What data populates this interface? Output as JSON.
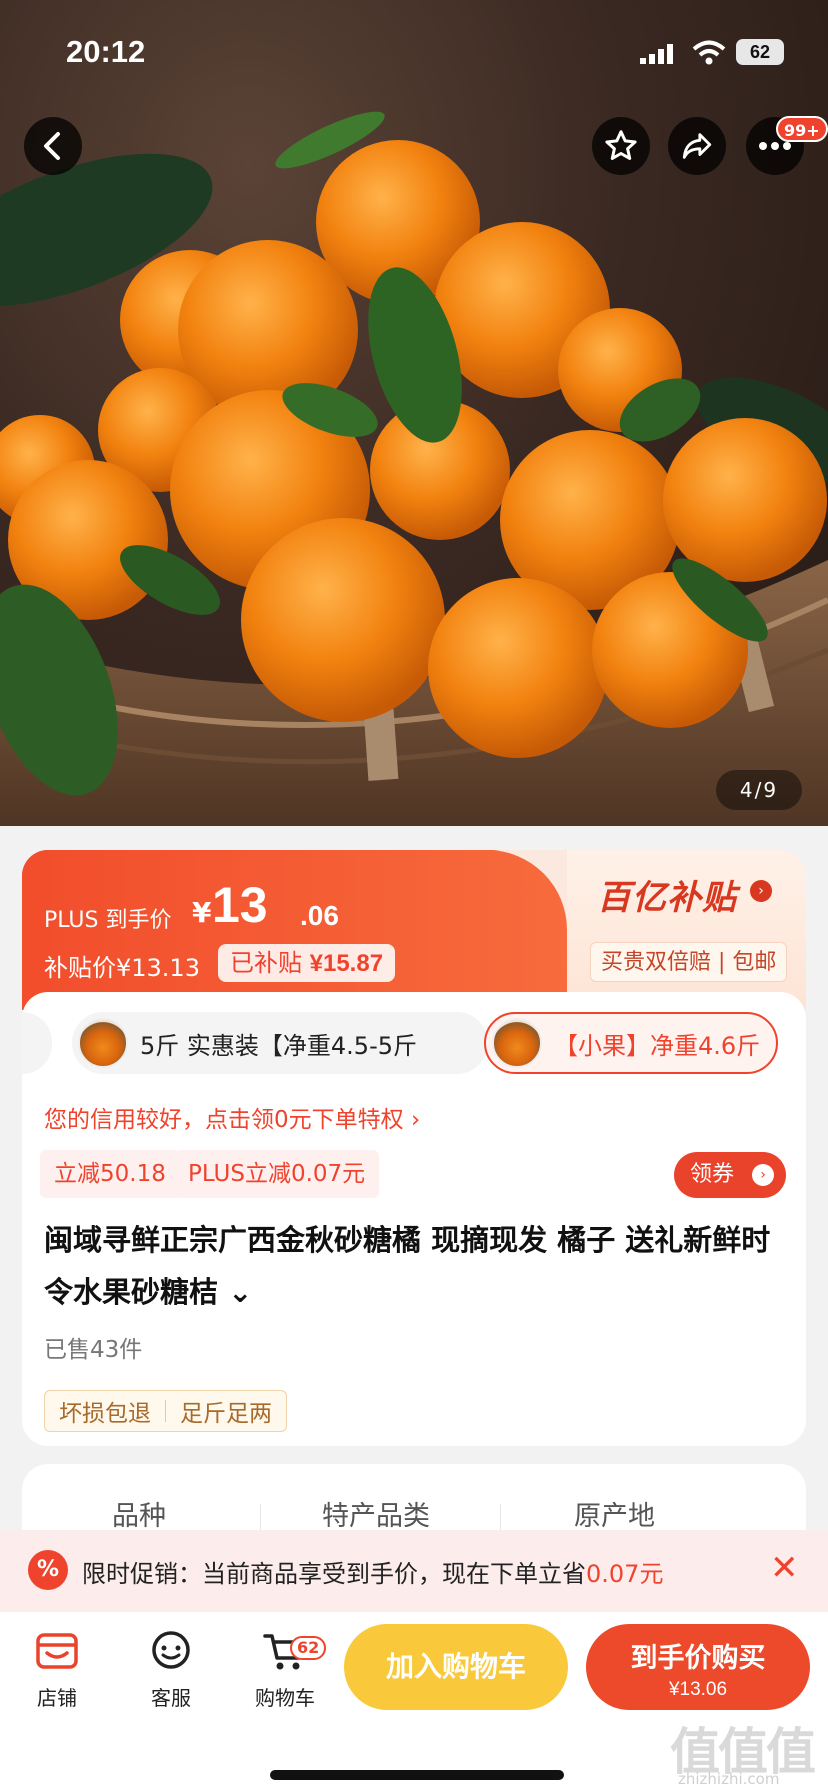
{
  "status": {
    "time": "20:12",
    "battery": "62"
  },
  "hero": {
    "page_indicator": "4/9",
    "more_badge": "99+"
  },
  "price": {
    "plus_label": "PLUS 到手价",
    "currency": "¥",
    "amount_int": "13",
    "amount_dec": ".06",
    "subsidy_price": "补贴价¥13.13",
    "subsidized_label": "已补贴",
    "subsidized_amount": "¥15.87",
    "bybt_logo": "百亿补贴",
    "bybt_tag": "买贵双倍赔 | 包邮"
  },
  "variants": [
    {
      "label": "5斤 实惠装【净重4.5-5斤",
      "selected": false
    },
    {
      "label": "【小果】净重4.6斤",
      "selected": true
    }
  ],
  "credit_text": "您的信用较好，点击领0元下单特权 ›",
  "promos": [
    "立减50.18",
    "PLUS立减0.07元"
  ],
  "coupon_label": "领券",
  "product_title": "闽域寻鲜正宗广西金秋砂糖橘 现摘现发 橘子 送礼新鲜时令水果砂糖桔 ⌄",
  "sold": "已售43件",
  "guarantees": [
    "坏损包退",
    "足斤足两"
  ],
  "specs": [
    "品种",
    "特产品类",
    "原产地"
  ],
  "promo_bar": {
    "prefix": "限时促销：当前商品享受到手价，现在下单立省",
    "amount": "0.07元",
    "icon": "%"
  },
  "bottom_bar": {
    "store": "店铺",
    "service": "客服",
    "cart": "购物车",
    "cart_count": "62",
    "add_to_cart": "加入购物车",
    "buy_label": "到手价购买",
    "buy_price": "¥13.06"
  },
  "watermark": {
    "logo": "值值值",
    "url": "zhizhizhi.com"
  },
  "colors": {
    "accent": "#f0432d",
    "cart_button": "#f9c93b",
    "buy_button": "#ec4a2b"
  }
}
